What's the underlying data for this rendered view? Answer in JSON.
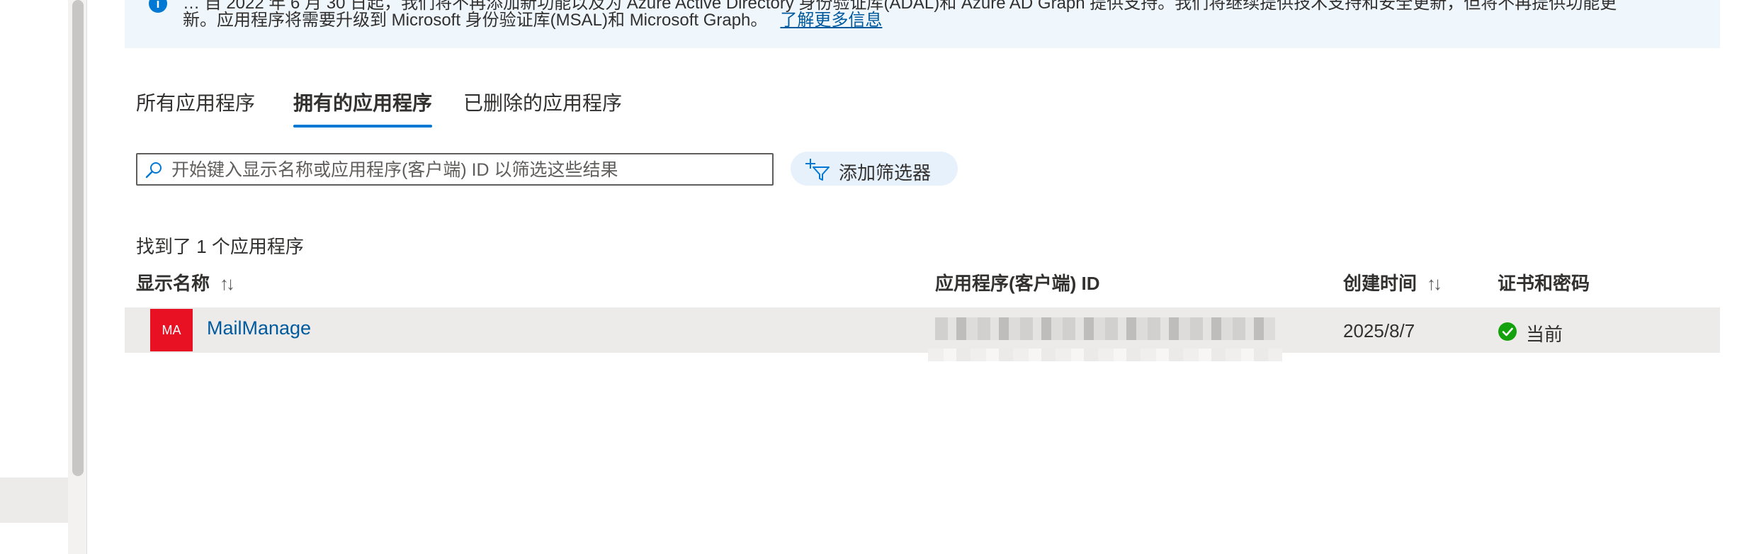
{
  "banner": {
    "line1": "… 自 2022 年 6 月 30 日起，我们将不再添加新功能以及为 Azure Active Directory 身份验证库(ADAL)和 Azure AD Graph 提供支持。我们将继续提供技术支持和安全更新，但将不再提供功能更",
    "line2": "新。应用程序将需要升级到 Microsoft 身份验证库(MSAL)和 Microsoft Graph。",
    "link": "了解更多信息"
  },
  "tabs": [
    {
      "label": "所有应用程序",
      "active": false
    },
    {
      "label": "拥有的应用程序",
      "active": true
    },
    {
      "label": "已删除的应用程序",
      "active": false
    }
  ],
  "search": {
    "placeholder": "开始键入显示名称或应用程序(客户端) ID 以筛选这些结果",
    "value": ""
  },
  "filter": {
    "label": "添加筛选器"
  },
  "results": {
    "count_text": "找到了 1 个应用程序"
  },
  "columns": {
    "display_name": "显示名称",
    "client_id": "应用程序(客户端) ID",
    "created": "创建时间",
    "certs": "证书和密码"
  },
  "sort_icon": "↑↓",
  "rows": [
    {
      "logo_text": "MA",
      "name": "MailManage",
      "created": "2025/8/7",
      "cert_status": "当前"
    }
  ],
  "colors": {
    "accent": "#0078d4",
    "link": "#005a9e",
    "app_logo": "#e81123",
    "status_ok": "#13a10e",
    "banner_bg": "#eff6fc",
    "row_selected": "#edebe9"
  },
  "icons": {
    "banner": "info-icon",
    "search": "search-icon",
    "filter": "filter-add-icon",
    "status": "check-circle-icon"
  }
}
